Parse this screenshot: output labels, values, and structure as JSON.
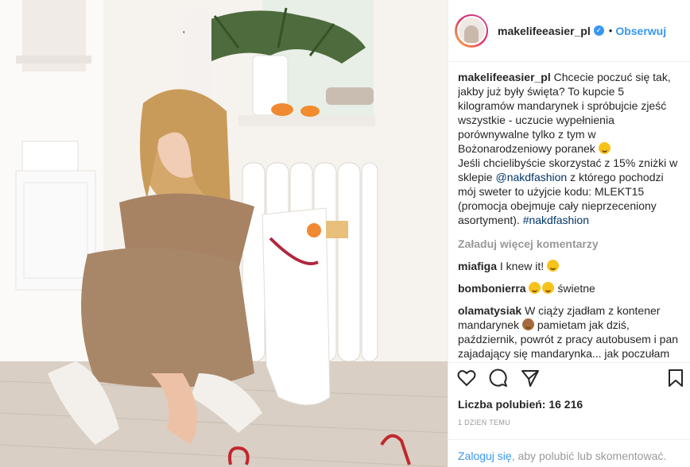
{
  "post": {
    "username": "makelifeeasier_pl",
    "verified_icon": "check-icon",
    "separator": "•",
    "follow_label": "Obserwuj",
    "caption": {
      "username": "makelifeeasier_pl",
      "text1": "Chcecie poczuć się tak, jakby już były święta? To kupcie 5 kilogramów mandarynek i spróbujcie zjeść wszystkie - uczucie wypełnienia porównywalne tylko z tym w Bożonarodzeniowy poranek",
      "text2": "Jeśli chcielibyście skorzystać z 15% zniżki w sklepie",
      "mention": "@nakdfashion",
      "text3": "z którego pochodzi mój sweter to użyjcie kodu:  MLEKT15 (promocja obejmuje cały nieprzeceniony asortyment).",
      "hashtag": "#nakdfashion"
    },
    "load_more": "Załaduj więcej komentarzy",
    "comments": [
      {
        "user": "miafiga",
        "text": "I knew it!"
      },
      {
        "user": "bombonierra",
        "text": "świetne"
      },
      {
        "user": "olamatysiak",
        "text1": "W ciąży zjadłam z kontener mandarynek",
        "text2": "pamietam jak dziś, październik, powrót z pracy autobusem i pan zajadający się mandarynka... jak poczułam ten zapach to resztki rozsadku"
      }
    ],
    "likes_label": "Liczba polubień: 16 216",
    "date": "1 DZIEŃ TEMU",
    "login": {
      "link": "Zaloguj się",
      "text": ", aby polubić lub skomentować."
    },
    "icons": [
      "heart-icon",
      "comment-icon",
      "share-icon",
      "bookmark-icon"
    ],
    "colors": {
      "accent": "#3897f0",
      "text": "#262626",
      "muted": "#999999",
      "border": "#efefef"
    }
  }
}
